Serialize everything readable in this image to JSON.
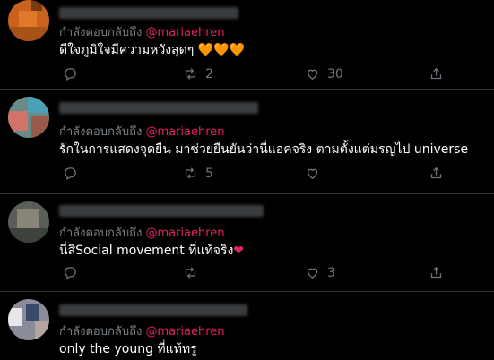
{
  "reply_prefix": "กำลังตอบกลับถึง",
  "tweets": [
    {
      "handle": "@mariaehren",
      "text": "ดีใจภูมิใจมีความหวังสุดๆ",
      "emoji": "🧡🧡🧡",
      "replies": "",
      "retweets": "2",
      "likes": "30"
    },
    {
      "handle": "@mariaehren",
      "text": "รักในการแสดงจุดยืน มาช่วยยืนยันว่านี่แอคจริง ตามตั้งแต่มรญไป universe",
      "replies": "",
      "retweets": "5",
      "likes": ""
    },
    {
      "handle": "@mariaehren",
      "text": "นี่สิSocial movement ที่แท้จริง",
      "emoji": "❤",
      "replies": "",
      "retweets": "",
      "likes": "3"
    },
    {
      "handle": "@mariaehren",
      "text": "only the young ที่แท้ทรู"
    }
  ],
  "colors": {
    "background": "#000000",
    "handle": "#e0245e",
    "muted": "#6e767d",
    "divider": "#2f3336"
  },
  "icons": [
    "reply-icon",
    "retweet-icon",
    "like-icon"
  ]
}
